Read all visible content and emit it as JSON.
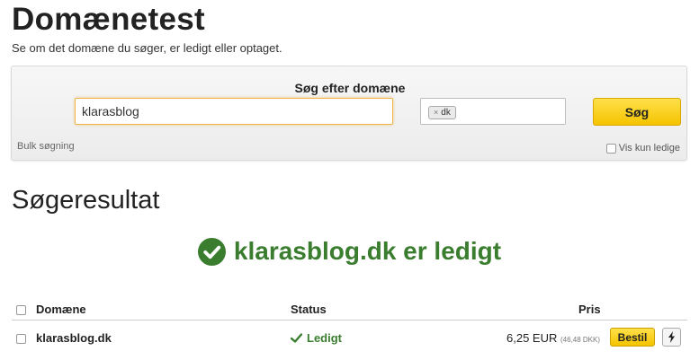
{
  "header": {
    "title": "Domænetest",
    "subtitle": "Se om det domæne du søger, er ledigt eller optaget."
  },
  "search": {
    "label": "Søg efter domæne",
    "domain_value": "klarasblog",
    "tld_chip": "dk",
    "tld_chip_remove": "×",
    "button_label": "Søg",
    "bulk_label": "Bulk søgning",
    "only_available_label": "Vis kun ledige"
  },
  "results": {
    "heading": "Søgeresultat",
    "banner": "klarasblog.dk er ledigt",
    "banner_color": "#3a7d2f",
    "columns": {
      "domain": "Domæne",
      "status": "Status",
      "price": "Pris"
    },
    "rows": [
      {
        "domain": "klarasblog.dk",
        "status": "Ledigt",
        "price": "6,25 EUR",
        "price_secondary": "(46,48 DKK)",
        "order_label": "Bestil"
      }
    ]
  },
  "colors": {
    "accent": "#f5c400",
    "success": "#3a7d2f"
  }
}
